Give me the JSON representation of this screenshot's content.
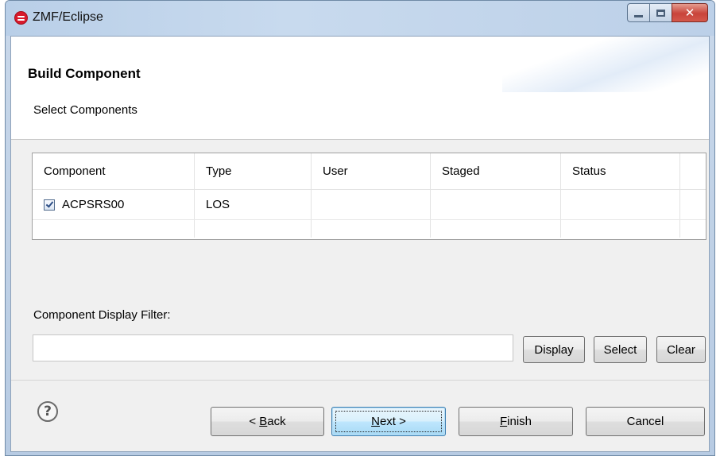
{
  "window": {
    "title": "ZMF/Eclipse"
  },
  "header": {
    "title": "Build Component",
    "subtitle": "Select Components"
  },
  "table": {
    "columns": [
      "Component",
      "Type",
      "User",
      "Staged",
      "Status"
    ],
    "rows": [
      {
        "checked": true,
        "component": "ACPSRS00",
        "type": "LOS",
        "user": "",
        "staged": "",
        "status": ""
      }
    ]
  },
  "filter": {
    "label": "Component Display Filter:",
    "value": "",
    "placeholder": ""
  },
  "filter_buttons": {
    "display": "Display",
    "select": "Select",
    "clear": "Clear"
  },
  "wizard_buttons": {
    "back_prefix": "< ",
    "back_mnemonic": "B",
    "back_rest": "ack",
    "next_mnemonic": "N",
    "next_rest": "ext >",
    "finish_mnemonic": "F",
    "finish_rest": "inish",
    "cancel": "Cancel"
  },
  "icons": {
    "app": "zmf-app-icon",
    "help": "help-icon",
    "help_glyph": "?"
  }
}
